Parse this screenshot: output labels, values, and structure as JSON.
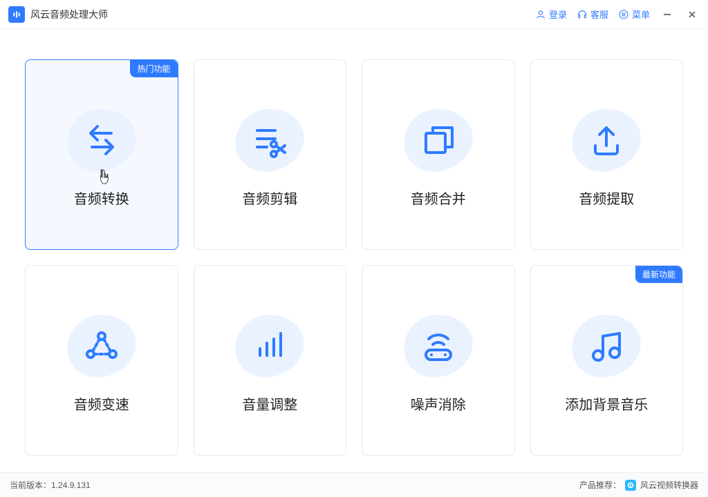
{
  "app": {
    "title": "风云音频处理大师"
  },
  "titlebar": {
    "login": "登录",
    "support": "客服",
    "menu": "菜单"
  },
  "badges": {
    "hot": "热门功能",
    "new": "最新功能"
  },
  "cards": {
    "convert": "音频转换",
    "edit": "音频剪辑",
    "merge": "音频合并",
    "extract": "音频提取",
    "speed": "音频变速",
    "volume": "音量调整",
    "denoise": "噪声消除",
    "bgm": "添加背景音乐"
  },
  "footer": {
    "version_label": "当前版本：",
    "version": "1.24.9.131",
    "recommend_label": "产品推荐：",
    "recommend_product": "风云视频转换器"
  }
}
